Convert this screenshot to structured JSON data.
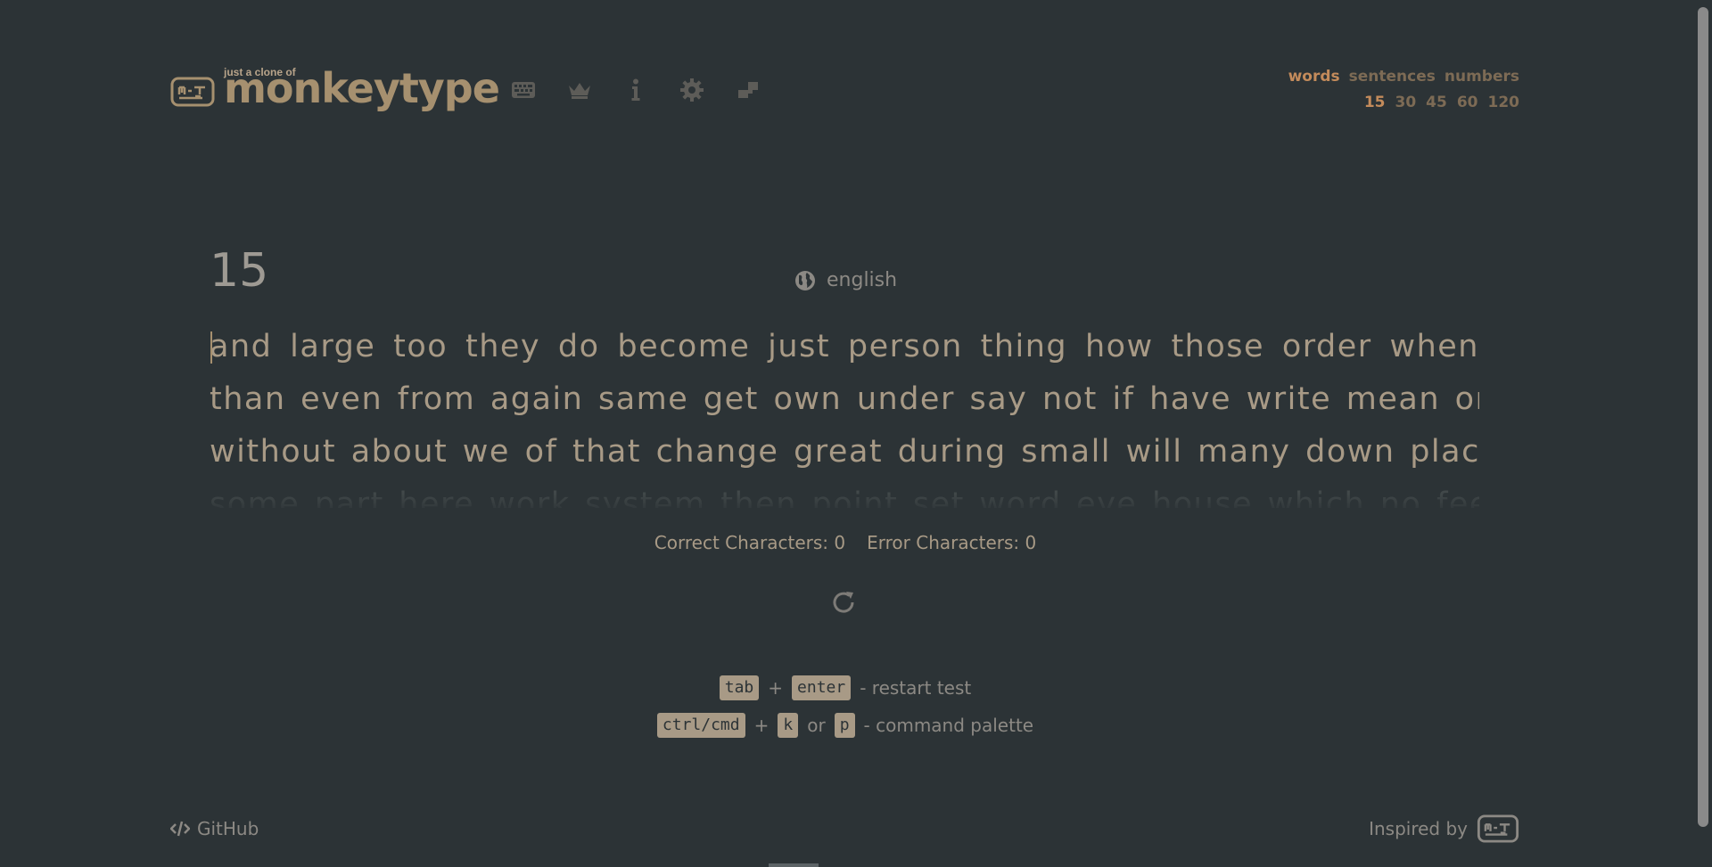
{
  "brand": {
    "tagline": "just a clone of",
    "name": "monkeytype"
  },
  "nav": {
    "icons": [
      "keyboard-icon",
      "crown-icon",
      "info-icon",
      "gear-icon",
      "theme-icon"
    ]
  },
  "modes": {
    "items": [
      "words",
      "sentences",
      "numbers"
    ],
    "active": "words"
  },
  "counts": {
    "items": [
      "15",
      "30",
      "45",
      "60",
      "120"
    ],
    "active": "15"
  },
  "test": {
    "remaining": "15",
    "language": "english",
    "lines": [
      "and large too they do become just person thing how those order when",
      "than even from again same get own under say not if have write mean one",
      "without about we of that change great during small will many down place",
      "some part here work system then point set word eye house which no feel"
    ]
  },
  "stats": {
    "correct_label": "Correct Characters: 0",
    "error_label": "Error Characters: 0"
  },
  "hints": {
    "row1": {
      "key1": "tab",
      "plus": "+",
      "key2": "enter",
      "text": "- restart test"
    },
    "row2": {
      "key1": "ctrl/cmd",
      "plus": "+",
      "key2": "k",
      "or": "or",
      "key3": "p",
      "text": "- command palette"
    }
  },
  "footer": {
    "github": "GitHub",
    "inspired": "Inspired by"
  },
  "colors": {
    "background": "#2c3336",
    "accent": "#c38b5b",
    "text": "#a89a86",
    "muted": "#7d6b55"
  }
}
